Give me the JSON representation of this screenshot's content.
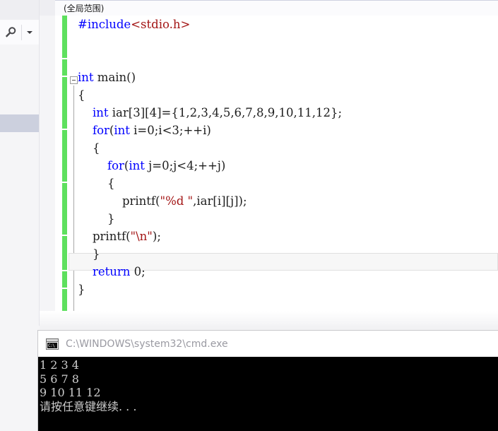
{
  "ide": {
    "left_strip": {
      "find_icon": "search-icon",
      "find_dropdown_icon": "chevron-down-icon"
    },
    "scope_bar": {
      "scope_label": "(全局范围)"
    },
    "editor": {
      "fold_icon": "collapse-minus-icon",
      "change_bar_color": "#5ee05e",
      "current_line_index": 13,
      "lines": [
        {
          "indent": 0,
          "tokens": [
            {
              "t": "#include",
              "c": "pp"
            },
            {
              "t": "<stdio.h>",
              "c": "str"
            }
          ]
        },
        {
          "indent": 0,
          "tokens": []
        },
        {
          "indent": 0,
          "tokens": []
        },
        {
          "indent": 0,
          "tokens": [
            {
              "t": "int",
              "c": "k"
            },
            {
              "t": " main()",
              "c": "pln"
            }
          ]
        },
        {
          "indent": 0,
          "tokens": [
            {
              "t": "{",
              "c": "pln"
            }
          ]
        },
        {
          "indent": 1,
          "tokens": [
            {
              "t": "int",
              "c": "k"
            },
            {
              "t": " iar[3][4]={1,2,3,4,5,6,7,8,9,10,11,12};",
              "c": "pln"
            }
          ]
        },
        {
          "indent": 1,
          "tokens": [
            {
              "t": "for",
              "c": "k"
            },
            {
              "t": "(",
              "c": "pln"
            },
            {
              "t": "int",
              "c": "k"
            },
            {
              "t": " i=0;i<3;++i)",
              "c": "pln"
            }
          ]
        },
        {
          "indent": 1,
          "tokens": [
            {
              "t": "{",
              "c": "pln"
            }
          ]
        },
        {
          "indent": 2,
          "tokens": [
            {
              "t": "for",
              "c": "k"
            },
            {
              "t": "(",
              "c": "pln"
            },
            {
              "t": "int",
              "c": "k"
            },
            {
              "t": " j=0;j<4;++j)",
              "c": "pln"
            }
          ]
        },
        {
          "indent": 2,
          "tokens": [
            {
              "t": "{",
              "c": "pln"
            }
          ]
        },
        {
          "indent": 3,
          "tokens": [
            {
              "t": "printf(",
              "c": "pln"
            },
            {
              "t": "\"%d \"",
              "c": "str"
            },
            {
              "t": ",iar[i][j]);",
              "c": "pln"
            }
          ]
        },
        {
          "indent": 2,
          "tokens": [
            {
              "t": "}",
              "c": "pln"
            }
          ]
        },
        {
          "indent": 1,
          "tokens": [
            {
              "t": "printf(",
              "c": "pln"
            },
            {
              "t": "\"\\n\"",
              "c": "str"
            },
            {
              "t": ");",
              "c": "pln"
            }
          ]
        },
        {
          "indent": 1,
          "tokens": [
            {
              "t": "}",
              "c": "pln"
            }
          ]
        },
        {
          "indent": 1,
          "tokens": [
            {
              "t": "return",
              "c": "k"
            },
            {
              "t": " 0;",
              "c": "pln"
            }
          ]
        },
        {
          "indent": 0,
          "tokens": [
            {
              "t": "}",
              "c": "pln"
            }
          ]
        }
      ]
    }
  },
  "console": {
    "icon": "cmd-console-icon",
    "icon_glyph": "C:\\",
    "title": "C:\\WINDOWS\\system32\\cmd.exe",
    "output_lines": [
      "1 2 3 4",
      "5 6 7 8",
      "9 10 11 12",
      "请按任意键继续. . ."
    ]
  }
}
